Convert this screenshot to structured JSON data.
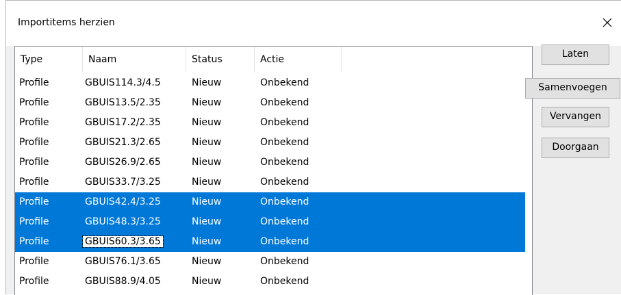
{
  "dialog": {
    "title": "Importitems herzien",
    "close_icon": "close-icon"
  },
  "table": {
    "columns": [
      "Type",
      "Naam",
      "Status",
      "Actie"
    ],
    "rows": [
      {
        "type": "Profile",
        "name": "GBUIS114.3/4.5",
        "status": "Nieuw",
        "action": "Onbekend",
        "selected": false
      },
      {
        "type": "Profile",
        "name": "GBUIS13.5/2.35",
        "status": "Nieuw",
        "action": "Onbekend",
        "selected": false
      },
      {
        "type": "Profile",
        "name": "GBUIS17.2/2.35",
        "status": "Nieuw",
        "action": "Onbekend",
        "selected": false
      },
      {
        "type": "Profile",
        "name": "GBUIS21.3/2.65",
        "status": "Nieuw",
        "action": "Onbekend",
        "selected": false
      },
      {
        "type": "Profile",
        "name": "GBUIS26.9/2.65",
        "status": "Nieuw",
        "action": "Onbekend",
        "selected": false
      },
      {
        "type": "Profile",
        "name": "GBUIS33.7/3.25",
        "status": "Nieuw",
        "action": "Onbekend",
        "selected": false
      },
      {
        "type": "Profile",
        "name": "GBUIS42.4/3.25",
        "status": "Nieuw",
        "action": "Onbekend",
        "selected": true
      },
      {
        "type": "Profile",
        "name": "GBUIS48.3/3.25",
        "status": "Nieuw",
        "action": "Onbekend",
        "selected": true
      },
      {
        "type": "Profile",
        "name": "GBUIS60.3/3.65",
        "status": "Nieuw",
        "action": "Onbekend",
        "selected": true,
        "focused": true
      },
      {
        "type": "Profile",
        "name": "GBUIS76.1/3.65",
        "status": "Nieuw",
        "action": "Onbekend",
        "selected": false
      },
      {
        "type": "Profile",
        "name": "GBUIS88.9/4.05",
        "status": "Nieuw",
        "action": "Onbekend",
        "selected": false
      }
    ]
  },
  "buttons": {
    "leave": "Laten",
    "merge": "Samenvoegen",
    "replace": "Vervangen",
    "continue": "Doorgaan"
  },
  "colors": {
    "selection": "#0078d7",
    "dialog_bg": "#f0f0f0",
    "button_bg": "#e1e1e1"
  }
}
